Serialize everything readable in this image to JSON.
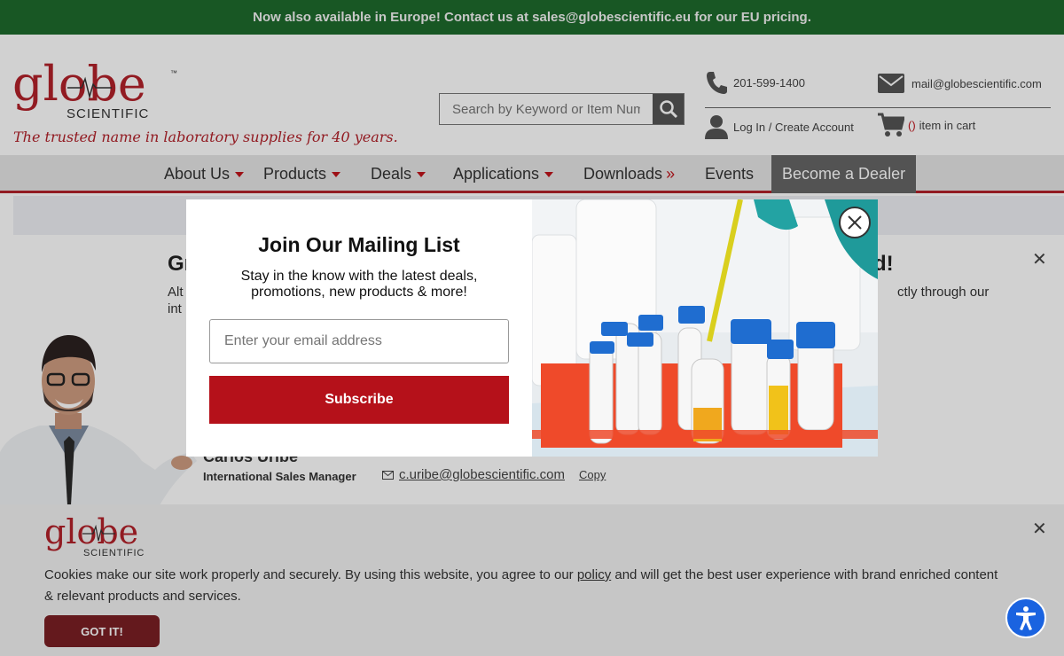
{
  "announcement": "Now also available in Europe! Contact us at sales@globescientific.eu for our EU pricing.",
  "logo": {
    "word": "globe",
    "sub": "SCIENTIFIC",
    "tm": "™"
  },
  "tagline": "The trusted name in laboratory supplies for 40 years.",
  "search": {
    "placeholder": "Search by Keyword or Item Number"
  },
  "contact": {
    "phone": "201-599-1400",
    "email": "mail@globescientific.com",
    "login": "Log In / Create Account",
    "cart_paren": "()",
    "cart_text": "item in cart"
  },
  "nav": {
    "about": "About Us",
    "products": "Products",
    "deals": "Deals",
    "applications": "Applications",
    "downloads": "Downloads",
    "downloads_suffix": "»",
    "events": "Events",
    "dealer": "Become a Dealer"
  },
  "content": {
    "title_start": "Gr",
    "title_end": "d!",
    "text_start": "Alt",
    "text_start2": "int",
    "text_end": "ctly through our"
  },
  "rep": {
    "name": "Carlos Uribe",
    "title": "International Sales Manager",
    "email": "c.uribe@globescientific.com",
    "copy": "Copy"
  },
  "popup": {
    "title": "Join Our Mailing List",
    "subtitle": "Stay in the know with the latest deals, promotions, new products & more!",
    "email_placeholder": "Enter your email address",
    "subscribe": "Subscribe"
  },
  "cookie": {
    "text_before": "Cookies make our site work properly and securely. By using this website, you agree to our ",
    "link": "policy",
    "text_after": " and will get the best user experience with brand enriched content & relevant products and services.",
    "button": "GOT IT!"
  },
  "colors": {
    "brand_red": "#b3222a",
    "top_green": "#1e6b2d",
    "subscribe_red": "#b5111a",
    "accessibility_blue": "#1a63e0"
  },
  "icons": [
    "phone-icon",
    "mail-icon",
    "user-icon",
    "cart-icon",
    "search-icon",
    "close-icon",
    "accessibility-icon"
  ]
}
